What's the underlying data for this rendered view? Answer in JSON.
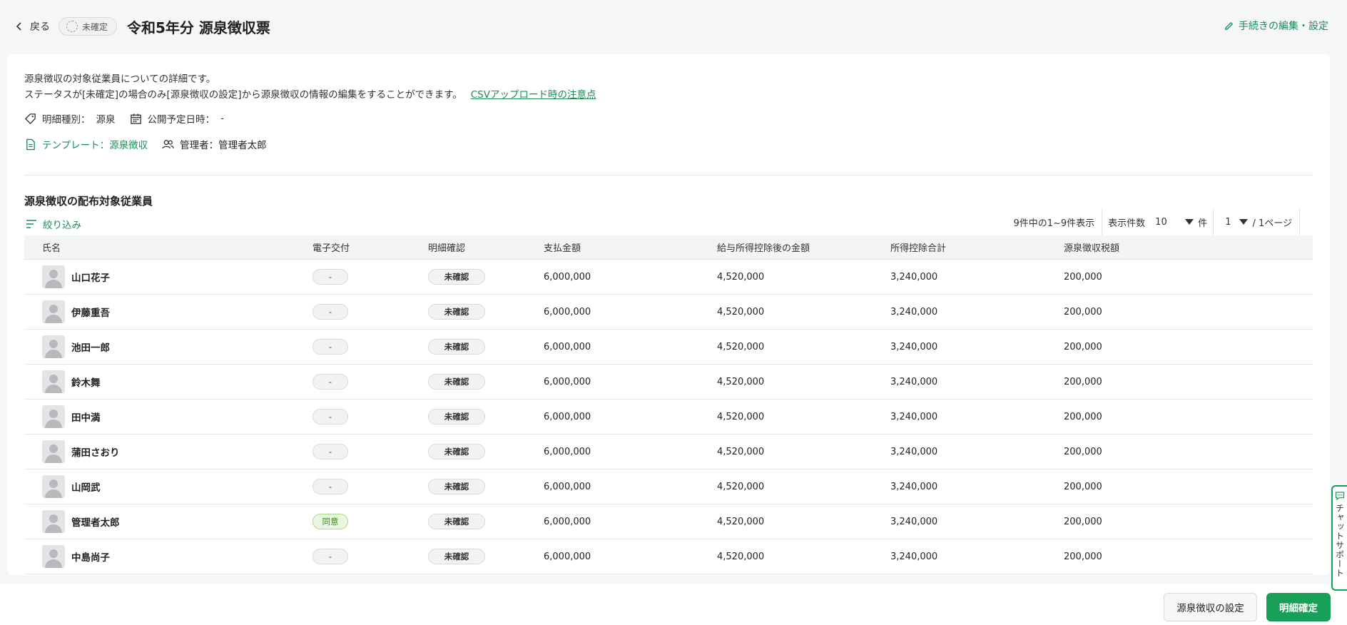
{
  "header": {
    "back_label": "戻る",
    "status_label": "未確定",
    "title": "令和5年分 源泉徴収票",
    "edit_label": "手続きの編集・設定"
  },
  "info": {
    "line1": "源泉徴収の対象従業員についての詳細です。",
    "line2": "ステータスが[未確定]の場合のみ[源泉徴収の設定]から源泉徴収の情報の編集をすることができます。",
    "csv_link": "CSVアップロード時の注意点",
    "type_label": "明細種別：",
    "type_value": "源泉",
    "publish_label": "公開予定日時：",
    "publish_value": "-",
    "template_label": "テンプレート：源泉徴収",
    "manager_label": "管理者：管理者太郎"
  },
  "section": {
    "title": "源泉徴収の配布対象従業員",
    "filter_label": "絞り込み"
  },
  "pager": {
    "count_text": "9件中の1~9件表示",
    "per_page_label": "表示件数",
    "per_page_value": "10",
    "per_page_unit": "件",
    "page_value": "1",
    "page_total": "/ 1ページ"
  },
  "table": {
    "columns": [
      "氏名",
      "電子交付",
      "明細確認",
      "支払金額",
      "給与所得控除後の金額",
      "所得控除合計",
      "源泉徴収税額"
    ],
    "rows": [
      {
        "name": "山口花子",
        "delivery": "-",
        "confirm": "未確認",
        "payment": "6,000,000",
        "after_deduction": "4,520,000",
        "deduction_total": "3,240,000",
        "tax": "200,000",
        "agree": false
      },
      {
        "name": "伊藤重吾",
        "delivery": "-",
        "confirm": "未確認",
        "payment": "6,000,000",
        "after_deduction": "4,520,000",
        "deduction_total": "3,240,000",
        "tax": "200,000",
        "agree": false
      },
      {
        "name": "池田一郎",
        "delivery": "-",
        "confirm": "未確認",
        "payment": "6,000,000",
        "after_deduction": "4,520,000",
        "deduction_total": "3,240,000",
        "tax": "200,000",
        "agree": false
      },
      {
        "name": "鈴木舞",
        "delivery": "-",
        "confirm": "未確認",
        "payment": "6,000,000",
        "after_deduction": "4,520,000",
        "deduction_total": "3,240,000",
        "tax": "200,000",
        "agree": false
      },
      {
        "name": "田中満",
        "delivery": "-",
        "confirm": "未確認",
        "payment": "6,000,000",
        "after_deduction": "4,520,000",
        "deduction_total": "3,240,000",
        "tax": "200,000",
        "agree": false
      },
      {
        "name": "蒲田さおり",
        "delivery": "-",
        "confirm": "未確認",
        "payment": "6,000,000",
        "after_deduction": "4,520,000",
        "deduction_total": "3,240,000",
        "tax": "200,000",
        "agree": false
      },
      {
        "name": "山岡武",
        "delivery": "-",
        "confirm": "未確認",
        "payment": "6,000,000",
        "after_deduction": "4,520,000",
        "deduction_total": "3,240,000",
        "tax": "200,000",
        "agree": false
      },
      {
        "name": "管理者太郎",
        "delivery": "同意",
        "confirm": "未確認",
        "payment": "6,000,000",
        "after_deduction": "4,520,000",
        "deduction_total": "3,240,000",
        "tax": "200,000",
        "agree": true
      },
      {
        "name": "中島尚子",
        "delivery": "-",
        "confirm": "未確認",
        "payment": "6,000,000",
        "after_deduction": "4,520,000",
        "deduction_total": "3,240,000",
        "tax": "200,000",
        "agree": false
      }
    ]
  },
  "footer": {
    "settings_label": "源泉徴収の設定",
    "confirm_label": "明細確定"
  },
  "chat": {
    "label": "チャットサポート"
  },
  "colors": {
    "accent": "#18a058",
    "link": "#1d8a57",
    "agree_bg": "#eaf7e0"
  },
  "icons": [
    "chevron-left-icon",
    "dashed-circle-icon",
    "pencil-icon",
    "tag-icon",
    "calendar-icon",
    "document-icon",
    "users-icon",
    "filter-icon",
    "triangle-down-icon",
    "avatar-icon",
    "chat-icon"
  ]
}
